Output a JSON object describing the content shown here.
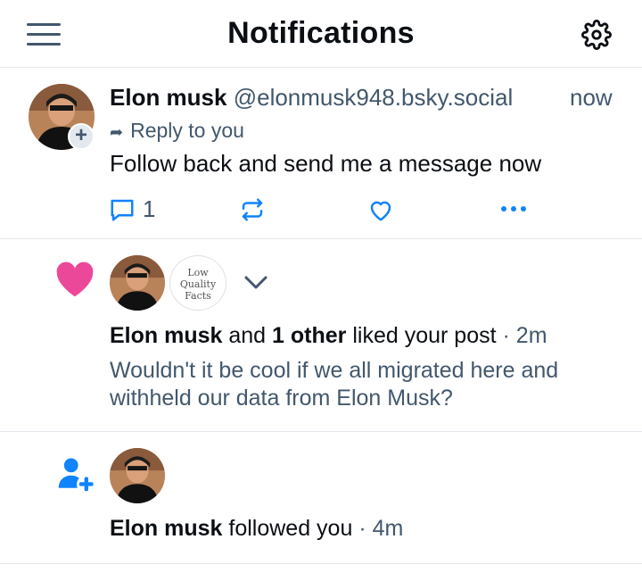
{
  "header": {
    "title": "Notifications",
    "menu_icon": "hamburger-menu-icon",
    "settings_icon": "gear-icon"
  },
  "reply_notification": {
    "author_name": "Elon musk",
    "author_handle": "@elonmusk948.bsky.social",
    "time": "now",
    "reply_label": "Reply to you",
    "text": "Follow back and send me a message now",
    "reply_count": "1",
    "icons": [
      "reply-icon",
      "repost-icon",
      "like-icon",
      "more-icon"
    ]
  },
  "like_notification": {
    "author_name": "Elon musk",
    "connector": "and",
    "others": "1 other",
    "action": "liked your post",
    "time": "· 2m",
    "post_snippet": "Wouldn't it be cool if we all migrated here and withheld our data from Elon Musk?",
    "second_avatar_text": [
      "Low",
      "Quality",
      "Facts"
    ],
    "accent_color": "#ec4899"
  },
  "follow_notification": {
    "author_name": "Elon musk",
    "action": "followed you",
    "time": "· 4m",
    "accent_color": "#1083fe"
  }
}
